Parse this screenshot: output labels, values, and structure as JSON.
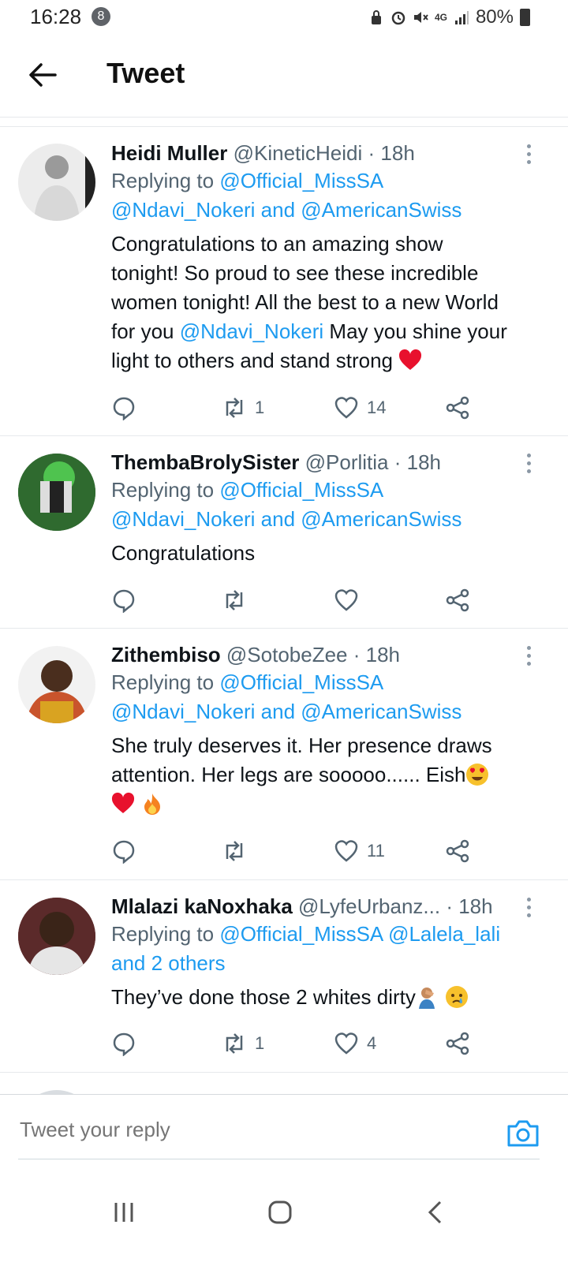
{
  "status_bar": {
    "time": "16:28",
    "badge": "8",
    "network": "4G",
    "battery": "80%"
  },
  "header": {
    "title": "Tweet"
  },
  "tweets": [
    {
      "name": "Heidi Muller",
      "handle": "@KineticHeidi",
      "time": "· 18h",
      "replying_prefix": "Replying to ",
      "replying_to_line1": "@Official_MissSA",
      "replying_to_line2": "@Ndavi_Nokeri and @AmericanSwiss",
      "text_line1": "Congratulations to an amazing show",
      "text_line2": "tonight! So proud to see these incredible",
      "text_line3": "women tonight! All the best to a new World",
      "text_line4_a": "for you ",
      "text_line4_mention": "@Ndavi_Nokeri",
      "text_line4_b": " May you shine your",
      "text_line5": "light to others and stand strong",
      "retweets": "1",
      "likes": "14"
    },
    {
      "name": "ThembaBrolySister",
      "handle": "@Porlitia",
      "time": "· 18h",
      "replying_prefix": "Replying to ",
      "replying_to_line1": "@Official_MissSA",
      "replying_to_line2": "@Ndavi_Nokeri and @AmericanSwiss",
      "text_line1": "Congratulations",
      "retweets": "",
      "likes": ""
    },
    {
      "name": "Zithembiso",
      "handle": "@SotobeZee",
      "time": "· 18h",
      "replying_prefix": "Replying to ",
      "replying_to_line1": "@Official_MissSA",
      "replying_to_line2": "@Ndavi_Nokeri and @AmericanSwiss",
      "text_line1": "She truly deserves it. Her presence draws",
      "text_line2": "attention. Her legs are sooooo...... Eish",
      "retweets": "",
      "likes": "11"
    },
    {
      "name": "Mlalazi kaNoxhaka",
      "handle": "@LyfeUrbanz...",
      "time": "· 18h",
      "replying_prefix": "Replying to ",
      "replying_to_line1": "@Official_MissSA @Lalela_lali",
      "replying_to_line2": "and 2 others",
      "text_line1": "They’ve done those 2 whites dirty",
      "retweets": "1",
      "likes": "4"
    }
  ],
  "reply_bar": {
    "placeholder": "Tweet your reply"
  },
  "colors": {
    "link": "#1d9bf0",
    "muted": "#536471",
    "heart": "#e0245e"
  }
}
